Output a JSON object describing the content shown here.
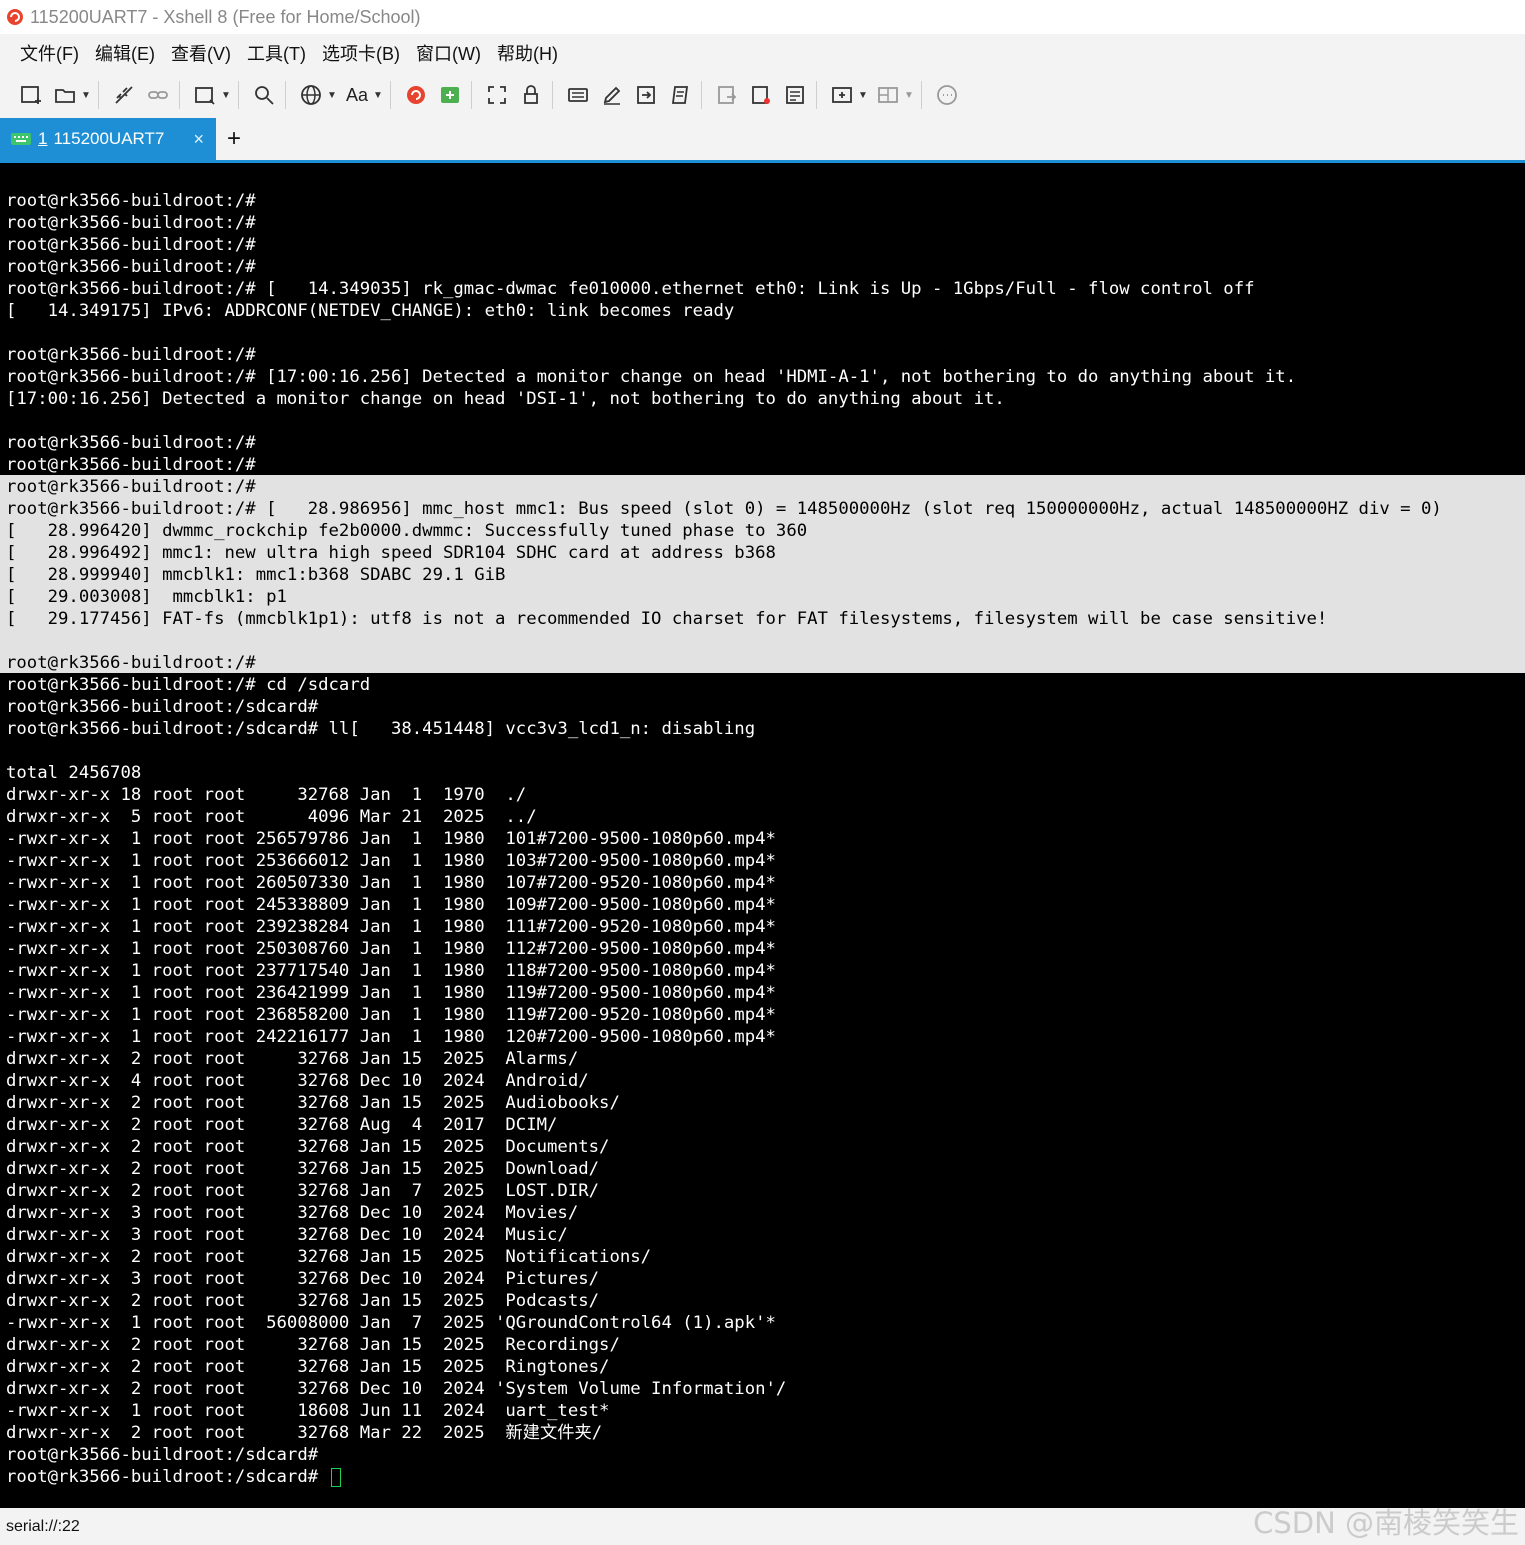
{
  "window": {
    "title": "115200UART7 - Xshell 8 (Free for Home/School)"
  },
  "menu": [
    "文件(F)",
    "编辑(E)",
    "查看(V)",
    "工具(T)",
    "选项卡(B)",
    "窗口(W)",
    "帮助(H)"
  ],
  "toolbar": {
    "font_label": "Aa"
  },
  "tab": {
    "number": "1",
    "label": "115200UART7",
    "close": "×",
    "add": "+"
  },
  "terminal": {
    "lines_before": [
      "root@rk3566-buildroot:/#",
      "root@rk3566-buildroot:/#",
      "root@rk3566-buildroot:/#",
      "root@rk3566-buildroot:/#",
      "root@rk3566-buildroot:/# [   14.349035] rk_gmac-dwmac fe010000.ethernet eth0: Link is Up - 1Gbps/Full - flow control off",
      "[   14.349175] IPv6: ADDRCONF(NETDEV_CHANGE): eth0: link becomes ready",
      "",
      "root@rk3566-buildroot:/#",
      "root@rk3566-buildroot:/# [17:00:16.256] Detected a monitor change on head 'HDMI-A-1', not bothering to do anything about it.",
      "[17:00:16.256] Detected a monitor change on head 'DSI-1', not bothering to do anything about it.",
      "",
      "root@rk3566-buildroot:/#",
      "root@rk3566-buildroot:/#"
    ],
    "lines_selected": [
      "root@rk3566-buildroot:/#",
      "root@rk3566-buildroot:/# [   28.986956] mmc_host mmc1: Bus speed (slot 0) = 148500000Hz (slot req 150000000Hz, actual 148500000HZ div = 0)",
      "[   28.996420] dwmmc_rockchip fe2b0000.dwmmc: Successfully tuned phase to 360",
      "[   28.996492] mmc1: new ultra high speed SDR104 SDHC card at address b368",
      "[   28.999940] mmcblk1: mmc1:b368 SDABC 29.1 GiB",
      "[   29.003008]  mmcblk1: p1",
      "[   29.177456] FAT-fs (mmcblk1p1): utf8 is not a recommended IO charset for FAT filesystems, filesystem will be case sensitive!",
      "",
      "root@rk3566-buildroot:/#"
    ],
    "lines_after": [
      "root@rk3566-buildroot:/# cd /sdcard",
      "root@rk3566-buildroot:/sdcard#",
      "root@rk3566-buildroot:/sdcard# ll[   38.451448] vcc3v3_lcd1_n: disabling",
      "",
      "total 2456708",
      "drwxr-xr-x 18 root root     32768 Jan  1  1970  ./",
      "drwxr-xr-x  5 root root      4096 Mar 21  2025  ../",
      "-rwxr-xr-x  1 root root 256579786 Jan  1  1980  101#7200-9500-1080p60.mp4*",
      "-rwxr-xr-x  1 root root 253666012 Jan  1  1980  103#7200-9500-1080p60.mp4*",
      "-rwxr-xr-x  1 root root 260507330 Jan  1  1980  107#7200-9520-1080p60.mp4*",
      "-rwxr-xr-x  1 root root 245338809 Jan  1  1980  109#7200-9500-1080p60.mp4*",
      "-rwxr-xr-x  1 root root 239238284 Jan  1  1980  111#7200-9520-1080p60.mp4*",
      "-rwxr-xr-x  1 root root 250308760 Jan  1  1980  112#7200-9500-1080p60.mp4*",
      "-rwxr-xr-x  1 root root 237717540 Jan  1  1980  118#7200-9500-1080p60.mp4*",
      "-rwxr-xr-x  1 root root 236421999 Jan  1  1980  119#7200-9500-1080p60.mp4*",
      "-rwxr-xr-x  1 root root 236858200 Jan  1  1980  119#7200-9520-1080p60.mp4*",
      "-rwxr-xr-x  1 root root 242216177 Jan  1  1980  120#7200-9500-1080p60.mp4*",
      "drwxr-xr-x  2 root root     32768 Jan 15  2025  Alarms/",
      "drwxr-xr-x  4 root root     32768 Dec 10  2024  Android/",
      "drwxr-xr-x  2 root root     32768 Jan 15  2025  Audiobooks/",
      "drwxr-xr-x  2 root root     32768 Aug  4  2017  DCIM/",
      "drwxr-xr-x  2 root root     32768 Jan 15  2025  Documents/",
      "drwxr-xr-x  2 root root     32768 Jan 15  2025  Download/",
      "drwxr-xr-x  2 root root     32768 Jan  7  2025  LOST.DIR/",
      "drwxr-xr-x  3 root root     32768 Dec 10  2024  Movies/",
      "drwxr-xr-x  3 root root     32768 Dec 10  2024  Music/",
      "drwxr-xr-x  2 root root     32768 Jan 15  2025  Notifications/",
      "drwxr-xr-x  3 root root     32768 Dec 10  2024  Pictures/",
      "drwxr-xr-x  2 root root     32768 Jan 15  2025  Podcasts/",
      "-rwxr-xr-x  1 root root  56008000 Jan  7  2025 'QGroundControl64 (1).apk'*",
      "drwxr-xr-x  2 root root     32768 Jan 15  2025  Recordings/",
      "drwxr-xr-x  2 root root     32768 Jan 15  2025  Ringtones/",
      "drwxr-xr-x  2 root root     32768 Dec 10  2024 'System Volume Information'/",
      "-rwxr-xr-x  1 root root     18608 Jun 11  2024  uart_test*",
      "drwxr-xr-x  2 root root     32768 Mar 22  2025  新建文件夹/",
      "root@rk3566-buildroot:/sdcard#"
    ],
    "prompt_line": "root@rk3566-buildroot:/sdcard#"
  },
  "status": {
    "connection": "serial://:22"
  },
  "watermark": "CSDN @南棱笑笑生",
  "colors": {
    "accent": "#1e8fd4",
    "terminal_bg": "#000000",
    "terminal_fg": "#ffffff",
    "selection_bg": "#e2e2e2",
    "cursor": "#1fd14a"
  }
}
